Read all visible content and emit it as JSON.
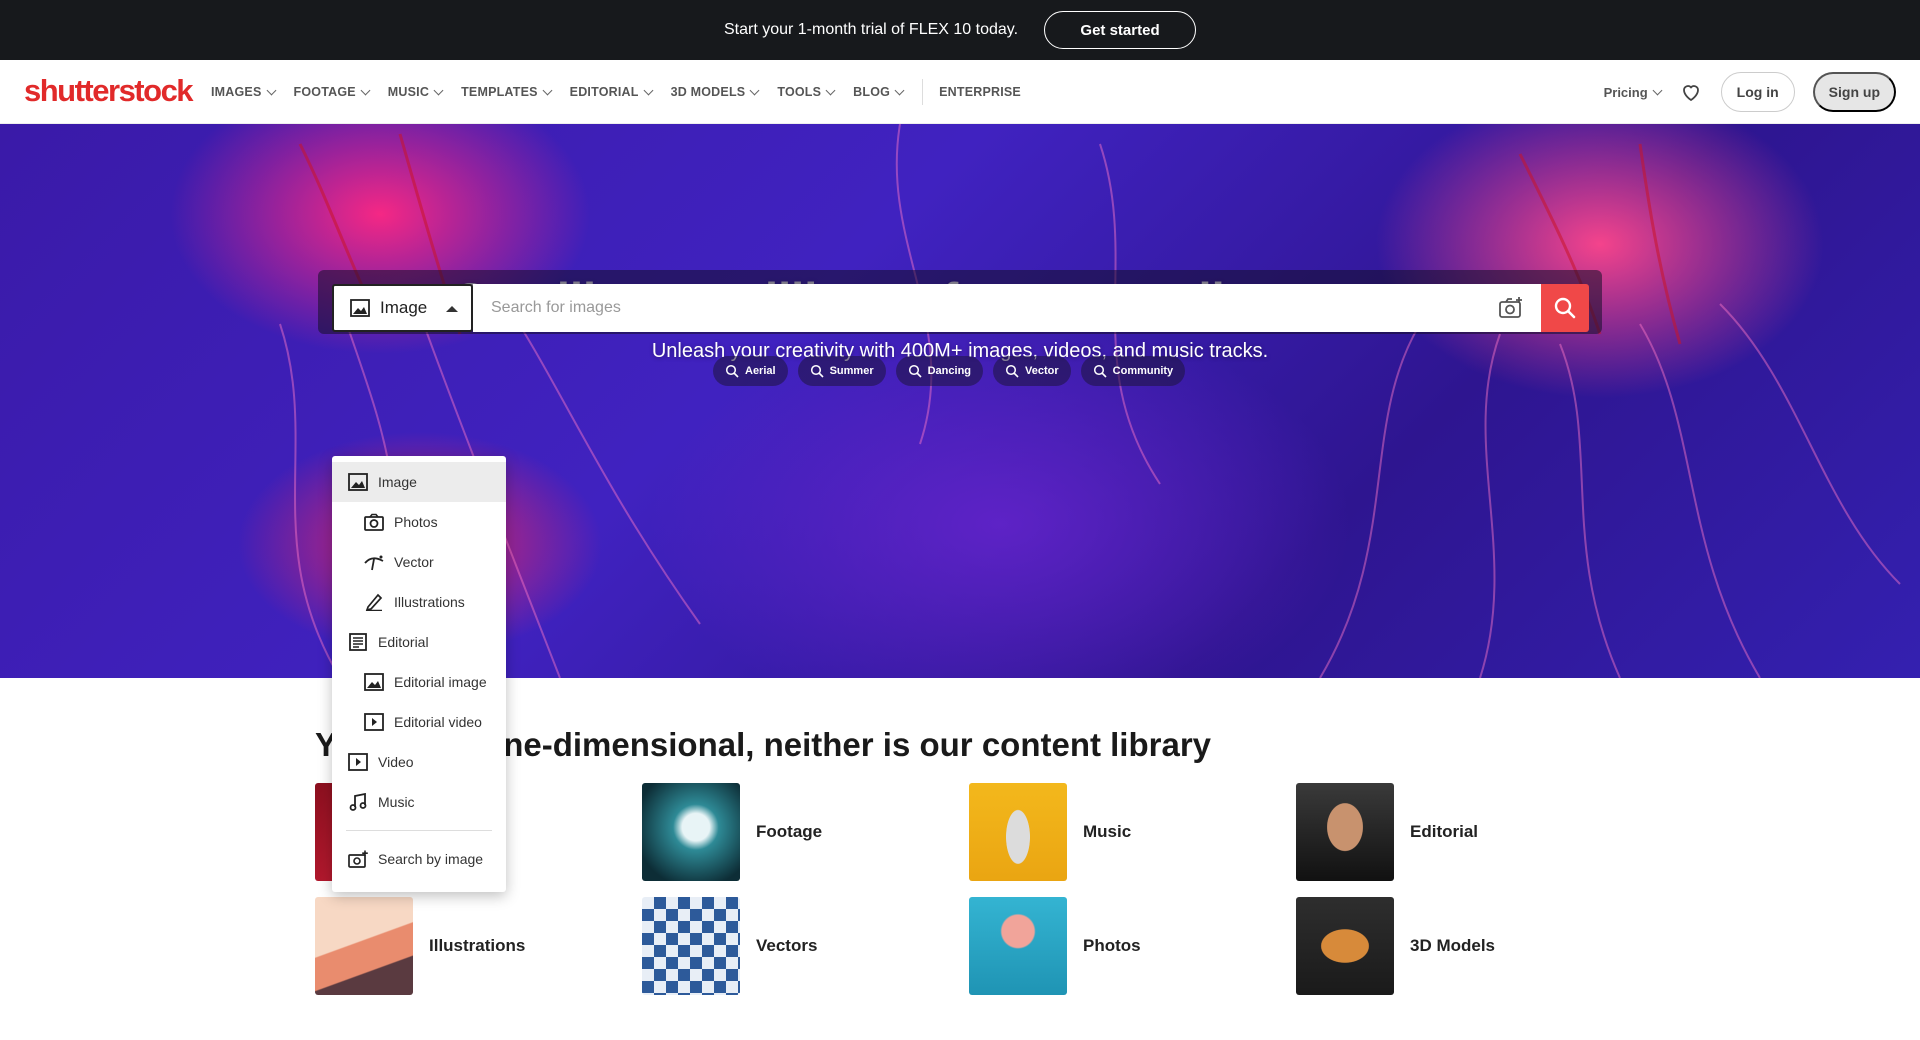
{
  "promo": {
    "text": "Start your 1-month trial of FLEX 10 today.",
    "button": "Get started"
  },
  "logo": "shutterstock",
  "nav": {
    "items": [
      {
        "label": "IMAGES",
        "dropdown": true
      },
      {
        "label": "FOOTAGE",
        "dropdown": true
      },
      {
        "label": "MUSIC",
        "dropdown": true
      },
      {
        "label": "TEMPLATES",
        "dropdown": true
      },
      {
        "label": "EDITORIAL",
        "dropdown": true
      },
      {
        "label": "3D MODELS",
        "dropdown": true
      },
      {
        "label": "TOOLS",
        "dropdown": true
      },
      {
        "label": "BLOG",
        "dropdown": true
      }
    ],
    "enterprise": "ENTERPRISE",
    "pricing": "Pricing",
    "login": "Log in",
    "signup": "Sign up"
  },
  "hero": {
    "title": "One library, millions of ways to tell your story",
    "subtitle": "Unleash your creativity with 400M+ images, videos, and music tracks."
  },
  "search": {
    "type_label": "Image",
    "placeholder": "Search for images",
    "chips": [
      "Aerial",
      "Summer",
      "Dancing",
      "Vector",
      "Community"
    ]
  },
  "dropdown": {
    "items": [
      {
        "label": "Image",
        "level": "top",
        "icon": "image-icon",
        "selected": true
      },
      {
        "label": "Photos",
        "level": "sub",
        "icon": "camera-icon"
      },
      {
        "label": "Vector",
        "level": "sub",
        "icon": "vector-icon"
      },
      {
        "label": "Illustrations",
        "level": "sub",
        "icon": "pen-icon"
      },
      {
        "label": "Editorial",
        "level": "top",
        "icon": "editorial-icon"
      },
      {
        "label": "Editorial image",
        "level": "sub",
        "icon": "image-icon"
      },
      {
        "label": "Editorial video",
        "level": "sub",
        "icon": "video-icon"
      },
      {
        "label": "Video",
        "level": "top",
        "icon": "video-icon"
      },
      {
        "label": "Music",
        "level": "top",
        "icon": "music-icon"
      }
    ],
    "search_by_image": "Search by image"
  },
  "section": {
    "title": "You aren’t one-dimensional, neither is our content library",
    "tiles": [
      {
        "label": "",
        "color": "#b8162a"
      },
      {
        "label": "Footage",
        "color": "#0f3f4a"
      },
      {
        "label": "Music",
        "color": "#f0b21a"
      },
      {
        "label": "Editorial",
        "color": "#2a2a2a"
      },
      {
        "label": "Illustrations",
        "color": "#f2c0a0"
      },
      {
        "label": "Vectors",
        "color": "#2d5a9a"
      },
      {
        "label": "Photos",
        "color": "#2aa8c8"
      },
      {
        "label": "3D Models",
        "color": "#2b2b2b"
      }
    ]
  },
  "colors": {
    "accent": "#f04848",
    "brand": "#e12a2a",
    "promo_bg": "#17191c"
  }
}
